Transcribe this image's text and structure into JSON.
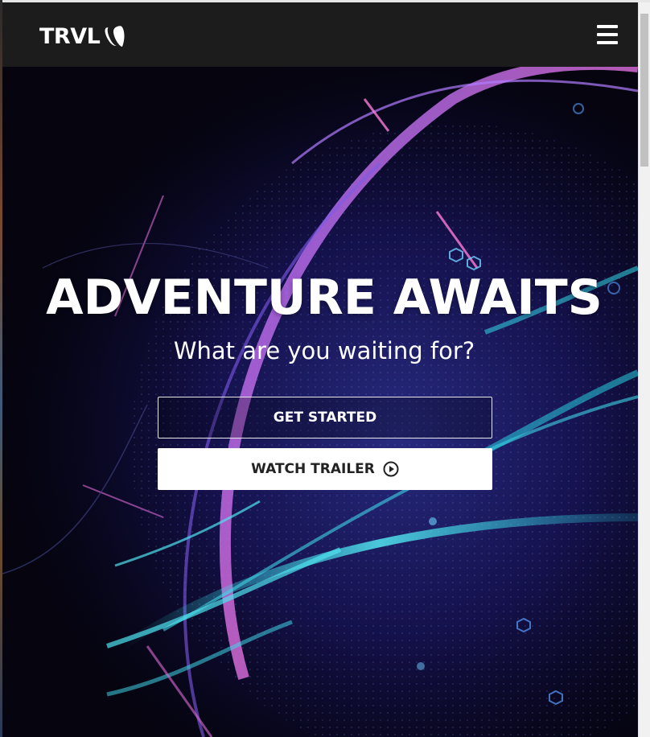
{
  "navbar": {
    "logo_text": "TRVL",
    "logo_icon": "typo3-icon",
    "menu_icon": "hamburger-menu-icon"
  },
  "hero": {
    "title": "ADVENTURE AWAITS",
    "subtitle": "What are you waiting for?",
    "primary_button": "GET STARTED",
    "secondary_button": "WATCH TRAILER",
    "secondary_button_icon": "play-circle-icon"
  },
  "colors": {
    "navbar_bg": "#1c1c1c",
    "hero_bg": "#0c0a2e",
    "accent_cyan": "#3fd6e6",
    "accent_violet": "#8a5cff",
    "accent_pink": "#e06bd8"
  }
}
